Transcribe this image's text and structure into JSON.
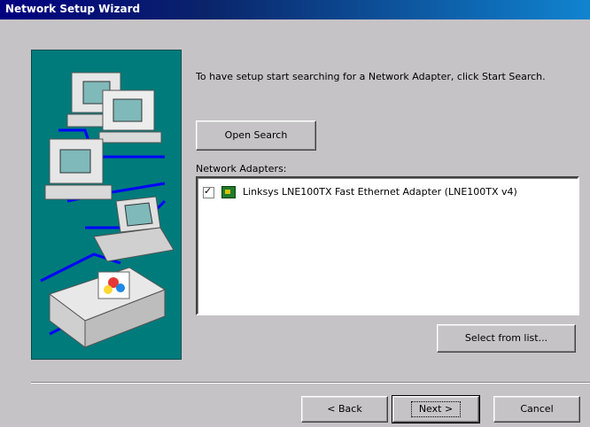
{
  "window": {
    "title": "Network Setup Wizard"
  },
  "intro_text": "To have setup start searching for a Network Adapter, click Start Search.",
  "buttons": {
    "open_search": "Open Search",
    "select_from_list": "Select from list...",
    "back": "< Back",
    "next": "Next >",
    "cancel": "Cancel"
  },
  "adapters": {
    "label": "Network Adapters:",
    "items": [
      {
        "checked": true,
        "icon": "network-adapter-icon",
        "text": "Linksys LNE100TX Fast Ethernet Adapter (LNE100TX v4)"
      }
    ]
  },
  "illustration": {
    "icons": [
      "computer-icon",
      "computer-icon",
      "computer-icon",
      "laptop-icon",
      "printer-icon"
    ],
    "accent_cables": "#0000ff"
  },
  "colors": {
    "title_start": "#000080",
    "title_end": "#1084d0",
    "dialog_bg": "#c6c3c6",
    "illustration_bg": "#007b7b"
  }
}
